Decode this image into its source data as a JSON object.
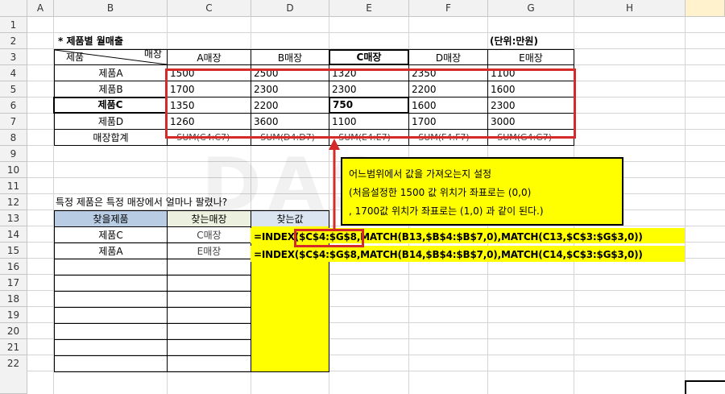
{
  "columns": [
    "A",
    "B",
    "C",
    "D",
    "E",
    "F",
    "G",
    "H"
  ],
  "rows": [
    "1",
    "2",
    "3",
    "4",
    "5",
    "6",
    "7",
    "8",
    "9",
    "10",
    "11",
    "12",
    "13",
    "14",
    "15",
    "16",
    "17",
    "18",
    "19",
    "20",
    "21",
    "22"
  ],
  "title": "* 제품별 월매출",
  "unit": "(단위:만원)",
  "diag_header": {
    "top": "매장",
    "bottom": "제품"
  },
  "store_headers": [
    "A매장",
    "B매장",
    "C매장",
    "D매장",
    "E매장"
  ],
  "products": [
    "제품A",
    "제품B",
    "제품C",
    "제품D"
  ],
  "values": [
    [
      "1500",
      "2500",
      "1320",
      "2350",
      "1100"
    ],
    [
      "1700",
      "2300",
      "2300",
      "2200",
      "1600"
    ],
    [
      "1350",
      "2200",
      "750",
      "1600",
      "2300"
    ],
    [
      "1260",
      "3600",
      "1100",
      "1700",
      "3000"
    ]
  ],
  "total_label": "매장합계",
  "totals": [
    "=SUM(C4:C7)",
    "=SUM(D4:D7)",
    "=SUM(E4:E7)",
    "=SUM(F4:F7)",
    "=SUM(G4:G7)"
  ],
  "question": "특정 제품은 특정 매장에서 얼마나 팔렸나?",
  "lookup_headers": [
    "찾을제품",
    "찾는매장",
    "찾는값"
  ],
  "lookup_rows": [
    {
      "product": "제품C",
      "store": "C매장",
      "formula_pre": "=INDEX(",
      "formula_range": "$C$4:$G$8",
      "formula_post": ",MATCH(B13,$B$4:$B$7,0),MATCH(C13,$C$3:$G$3,0))"
    },
    {
      "product": "제품A",
      "store": "E매장",
      "formula_pre": "=INDEX(",
      "formula_range": "$C$4:$G$8",
      "formula_post": ",MATCH(B14,$B$4:$B$7,0),MATCH(C14,$C$3:$G$3,0))"
    }
  ],
  "note": [
    "어느범위에서 값을 가져오는지 설정",
    " (처음설정한 1500 값 위치가 좌표로는 (0,0)",
    " ,  1700값 위치가 좌표로는 (1,0) 과 같이 된다.)"
  ],
  "watermark": "DAS",
  "colors": {
    "highlight": "#ffff00",
    "annotation_red": "#d42a2a",
    "header_bg": "#f2f2f2"
  }
}
